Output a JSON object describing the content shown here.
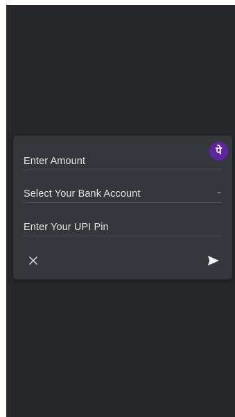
{
  "brand": {
    "logo_glyph": "पे",
    "logo_color": "#5f259f",
    "icon": "phonepe-logo-icon"
  },
  "form": {
    "amount_placeholder": "Enter Amount",
    "bank_select_value": "Select Your Bank Account",
    "upi_pin_placeholder": "Enter Your UPI Pin"
  },
  "actions": {
    "close_icon": "close-icon",
    "send_icon": "send-icon"
  },
  "colors": {
    "background": "#25272a",
    "dialog": "#34373b",
    "text": "#e3e4e6"
  }
}
